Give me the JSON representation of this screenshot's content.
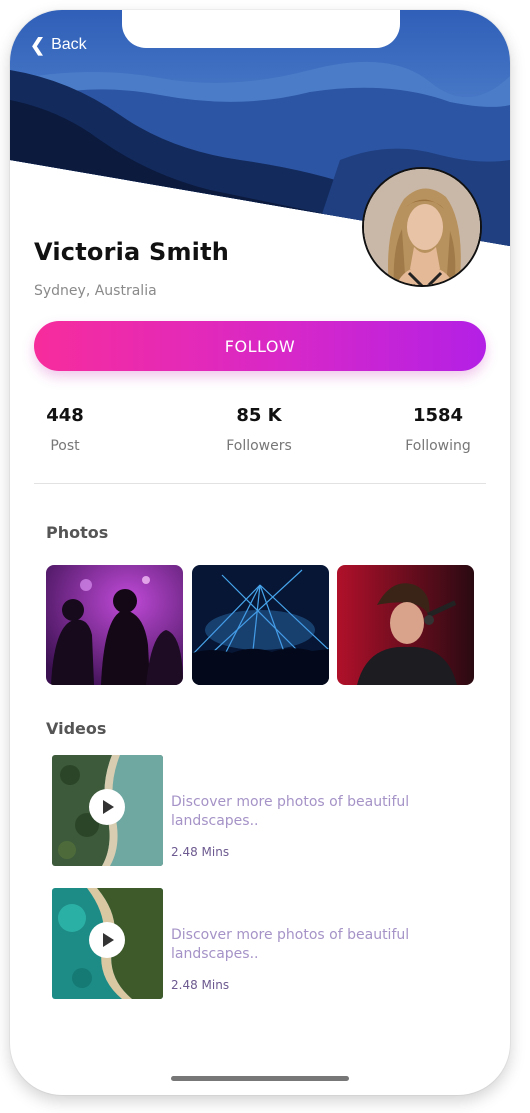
{
  "nav": {
    "back_label": "Back"
  },
  "profile": {
    "name": "Victoria Smith",
    "location": "Sydney, Australia"
  },
  "follow_label": "FOLLOW",
  "stats": [
    {
      "value": "448",
      "label": "Post"
    },
    {
      "value": "85 K",
      "label": "Followers"
    },
    {
      "value": "1584",
      "label": "Following"
    }
  ],
  "photos_title": "Photos",
  "videos_title": "Videos",
  "videos": [
    {
      "description": "Discover more photos of beautiful landscapes..",
      "duration": "2.48 Mins"
    },
    {
      "description": "Discover more photos of beautiful landscapes..",
      "duration": "2.48 Mins"
    }
  ],
  "colors": {
    "follow_start": "#f72c9c",
    "follow_end": "#b320e5",
    "video_text": "#a593c7"
  }
}
